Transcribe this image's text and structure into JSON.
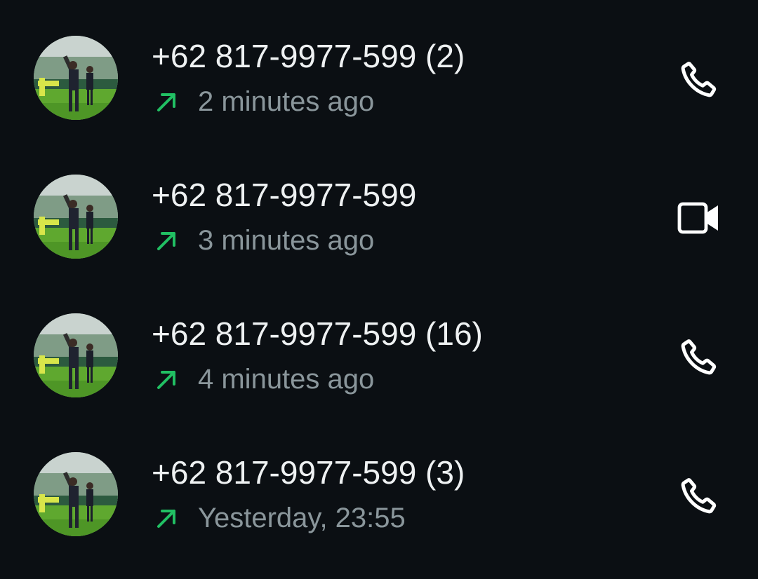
{
  "colors": {
    "background": "#0b0f13",
    "primary_text": "#eef1f2",
    "secondary_text": "#8a969b",
    "outgoing_arrow": "#21c063",
    "action_icon": "#ffffff"
  },
  "calls": [
    {
      "name": "+62 817-9977-599 (2)",
      "time": "2 minutes ago",
      "direction_icon": "outgoing-arrow-icon",
      "action": "voice-call",
      "action_icon": "phone-icon"
    },
    {
      "name": "+62 817-9977-599",
      "time": "3 minutes ago",
      "direction_icon": "outgoing-arrow-icon",
      "action": "video-call",
      "action_icon": "video-camera-icon"
    },
    {
      "name": "+62 817-9977-599 (16)",
      "time": "4 minutes ago",
      "direction_icon": "outgoing-arrow-icon",
      "action": "voice-call",
      "action_icon": "phone-icon"
    },
    {
      "name": "+62 817-9977-599 (3)",
      "time": "Yesterday, 23:55",
      "direction_icon": "outgoing-arrow-icon",
      "action": "voice-call",
      "action_icon": "phone-icon"
    }
  ]
}
